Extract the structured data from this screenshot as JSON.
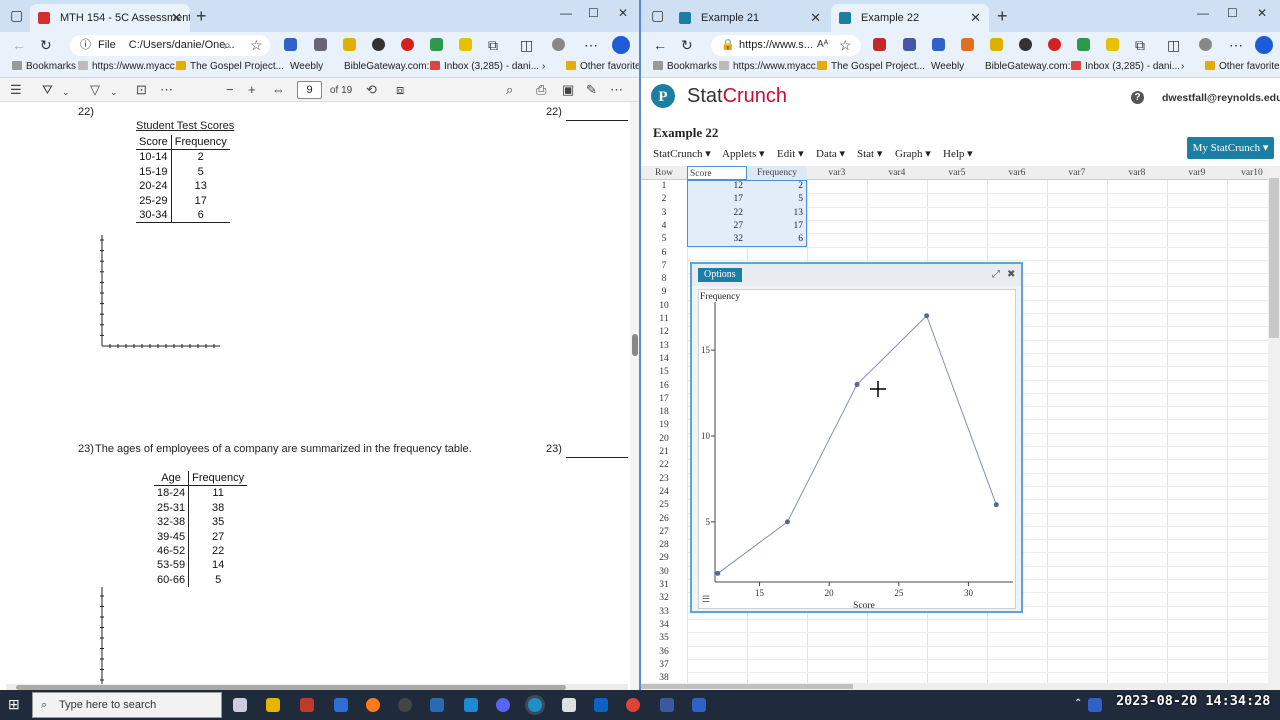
{
  "left_browser": {
    "tab_title": "MTH 154 - 5C Assessment Prep...",
    "address": "C:/Users/danie/One...",
    "address_scheme": "File",
    "bookmarks": [
      "Bookmarks",
      "https://www.myacc...",
      "The Gospel Project...",
      "Weebly",
      "BibleGateway.com:...",
      "Inbox (3,285) - dani...",
      "Other favorites"
    ],
    "pdf_toolbar": {
      "page": "9",
      "of_pages": "of 19"
    }
  },
  "right_browser": {
    "tabs": [
      {
        "title": "Example 21"
      },
      {
        "title": "Example 22"
      }
    ],
    "address": "https://www.s...",
    "bookmarks": [
      "Bookmarks",
      "https://www.myacc...",
      "The Gospel Project...",
      "Weebly",
      "BibleGateway.com:...",
      "Inbox (3,285) - dani...",
      "Other favorites"
    ]
  },
  "pdf": {
    "q22": {
      "number": "22)",
      "answer_label": "22)",
      "table_title": "Student Test Scores",
      "headers": [
        "Score",
        "Frequency"
      ],
      "rows": [
        [
          "10-14",
          "2"
        ],
        [
          "15-19",
          "5"
        ],
        [
          "20-24",
          "13"
        ],
        [
          "25-29",
          "17"
        ],
        [
          "30-34",
          "6"
        ]
      ]
    },
    "q23": {
      "number": "23)",
      "text": "The ages of employees of a company are summarized in the frequency table.",
      "answer_label": "23)",
      "headers": [
        "Age",
        "Frequency"
      ],
      "rows": [
        [
          "18-24",
          "11"
        ],
        [
          "25-31",
          "38"
        ],
        [
          "32-38",
          "35"
        ],
        [
          "39-45",
          "27"
        ],
        [
          "46-52",
          "22"
        ],
        [
          "53-59",
          "14"
        ],
        [
          "60-66",
          "5"
        ]
      ]
    }
  },
  "statcrunch": {
    "logo_stat": "Stat",
    "logo_crunch": "Crunch",
    "help": "?",
    "user": "dwestfall@reynolds.edu",
    "title": "Example 22",
    "menu": [
      "StatCrunch",
      "Applets",
      "Edit",
      "Data",
      "Stat",
      "Graph",
      "Help"
    ],
    "my_button": "My StatCrunch",
    "columns": [
      "Row",
      "Score",
      "Frequency",
      "var3",
      "var4",
      "var5",
      "var6",
      "var7",
      "var8",
      "var9",
      "var10"
    ],
    "data_rows": [
      [
        12,
        2
      ],
      [
        17,
        5
      ],
      [
        22,
        13
      ],
      [
        27,
        17
      ],
      [
        32,
        6
      ]
    ],
    "row_count": 38,
    "options_label": "Options"
  },
  "chart_data": {
    "type": "line",
    "x": [
      12,
      17,
      22,
      27,
      32
    ],
    "series": [
      {
        "values": [
          2,
          5,
          13,
          17,
          6
        ]
      }
    ],
    "xlabel": "Score",
    "ylabel": "Frequency",
    "xticks": [
      15,
      20,
      25,
      30
    ],
    "yticks": [
      5,
      10,
      15
    ],
    "xlim": [
      11.8,
      33.2
    ],
    "ylim": [
      1.5,
      17.8
    ]
  },
  "taskbar": {
    "search_placeholder": "Type here to search",
    "clock": "2023-08-20  14:34:28"
  },
  "colors": {
    "accent": "#1a7fa3",
    "split": "#5a8ad6",
    "line": "#8090b0"
  }
}
